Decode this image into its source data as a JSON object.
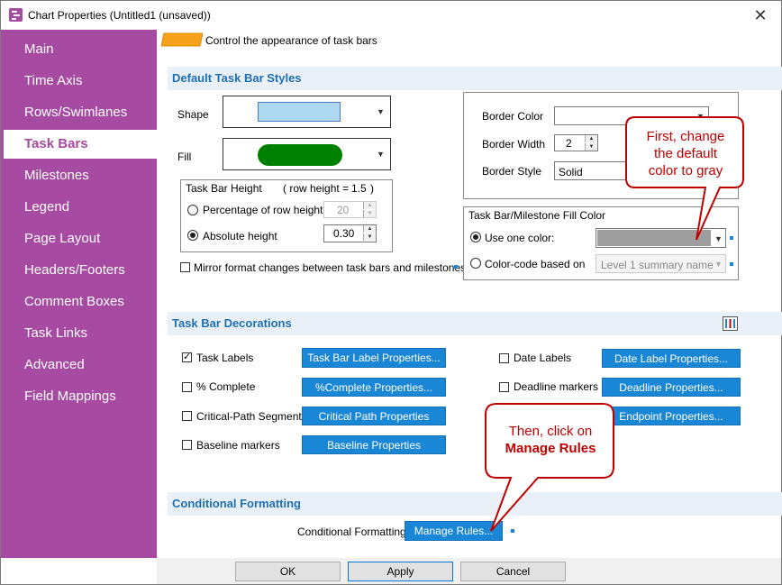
{
  "window": {
    "title": "Chart Properties (Untitled1 (unsaved))",
    "close_symbol": "✕"
  },
  "sidebar": {
    "items": [
      {
        "label": "Main"
      },
      {
        "label": "Time Axis"
      },
      {
        "label": "Rows/Swimlanes"
      },
      {
        "label": "Task Bars",
        "active": true
      },
      {
        "label": "Milestones"
      },
      {
        "label": "Legend"
      },
      {
        "label": "Page Layout"
      },
      {
        "label": "Headers/Footers"
      },
      {
        "label": "Comment Boxes"
      },
      {
        "label": "Task Links"
      },
      {
        "label": "Advanced"
      },
      {
        "label": "Field Mappings"
      }
    ],
    "color": "#a64aa2"
  },
  "header": {
    "description": "Control the appearance of task bars"
  },
  "default_styles": {
    "title": "Default Task Bar Styles",
    "shape_label": "Shape",
    "fill_label": "Fill",
    "fill_color": "#008000",
    "shape_color": "#add8f0",
    "height_group": {
      "title": "Task Bar Height",
      "row_height_text": "( row height =",
      "row_height_value": "1.5",
      "row_height_close": ")",
      "percentage_label": "Percentage of row height",
      "percentage_value": "20",
      "absolute_label": "Absolute height",
      "absolute_value": "0.30"
    },
    "mirror_label": "Mirror format changes between task bars and milestones",
    "border_color_label": "Border Color",
    "border_width_label": "Border Width",
    "border_width_value": "2",
    "border_style_label": "Border Style",
    "border_style_value": "Solid",
    "fill_color_group": {
      "title": "Task Bar/Milestone Fill Color",
      "use_one_color_label": "Use one color:",
      "one_color_value": "#9e9e9e",
      "color_code_label": "Color-code based on",
      "color_code_value": "Level 1 summary name"
    }
  },
  "decorations": {
    "title": "Task Bar Decorations",
    "rows": [
      {
        "label": "Task Labels",
        "checked": true,
        "button": "Task Bar Label Properties..."
      },
      {
        "label": "% Complete",
        "checked": false,
        "button": "%Complete Properties..."
      },
      {
        "label": "Critical-Path Segments",
        "checked": false,
        "button": "Critical Path Properties"
      },
      {
        "label": "Baseline markers",
        "checked": false,
        "button": "Baseline Properties"
      }
    ],
    "right_rows": [
      {
        "label": "Date Labels",
        "checked": false,
        "button": "Date Label Properties..."
      },
      {
        "label": "Deadline markers",
        "checked": false,
        "button": "Deadline Properties..."
      },
      {
        "button": "Endpoint Properties..."
      }
    ]
  },
  "conditional": {
    "title": "Conditional Formatting",
    "label": "Conditional Formatting",
    "button": "Manage Rules..."
  },
  "footer": {
    "ok": "OK",
    "apply": "Apply",
    "cancel": "Cancel"
  },
  "callouts": {
    "first": [
      "First, change",
      "the default",
      "color to gray"
    ],
    "second_line1": "Then, click on",
    "second_line2": "Manage Rules"
  }
}
